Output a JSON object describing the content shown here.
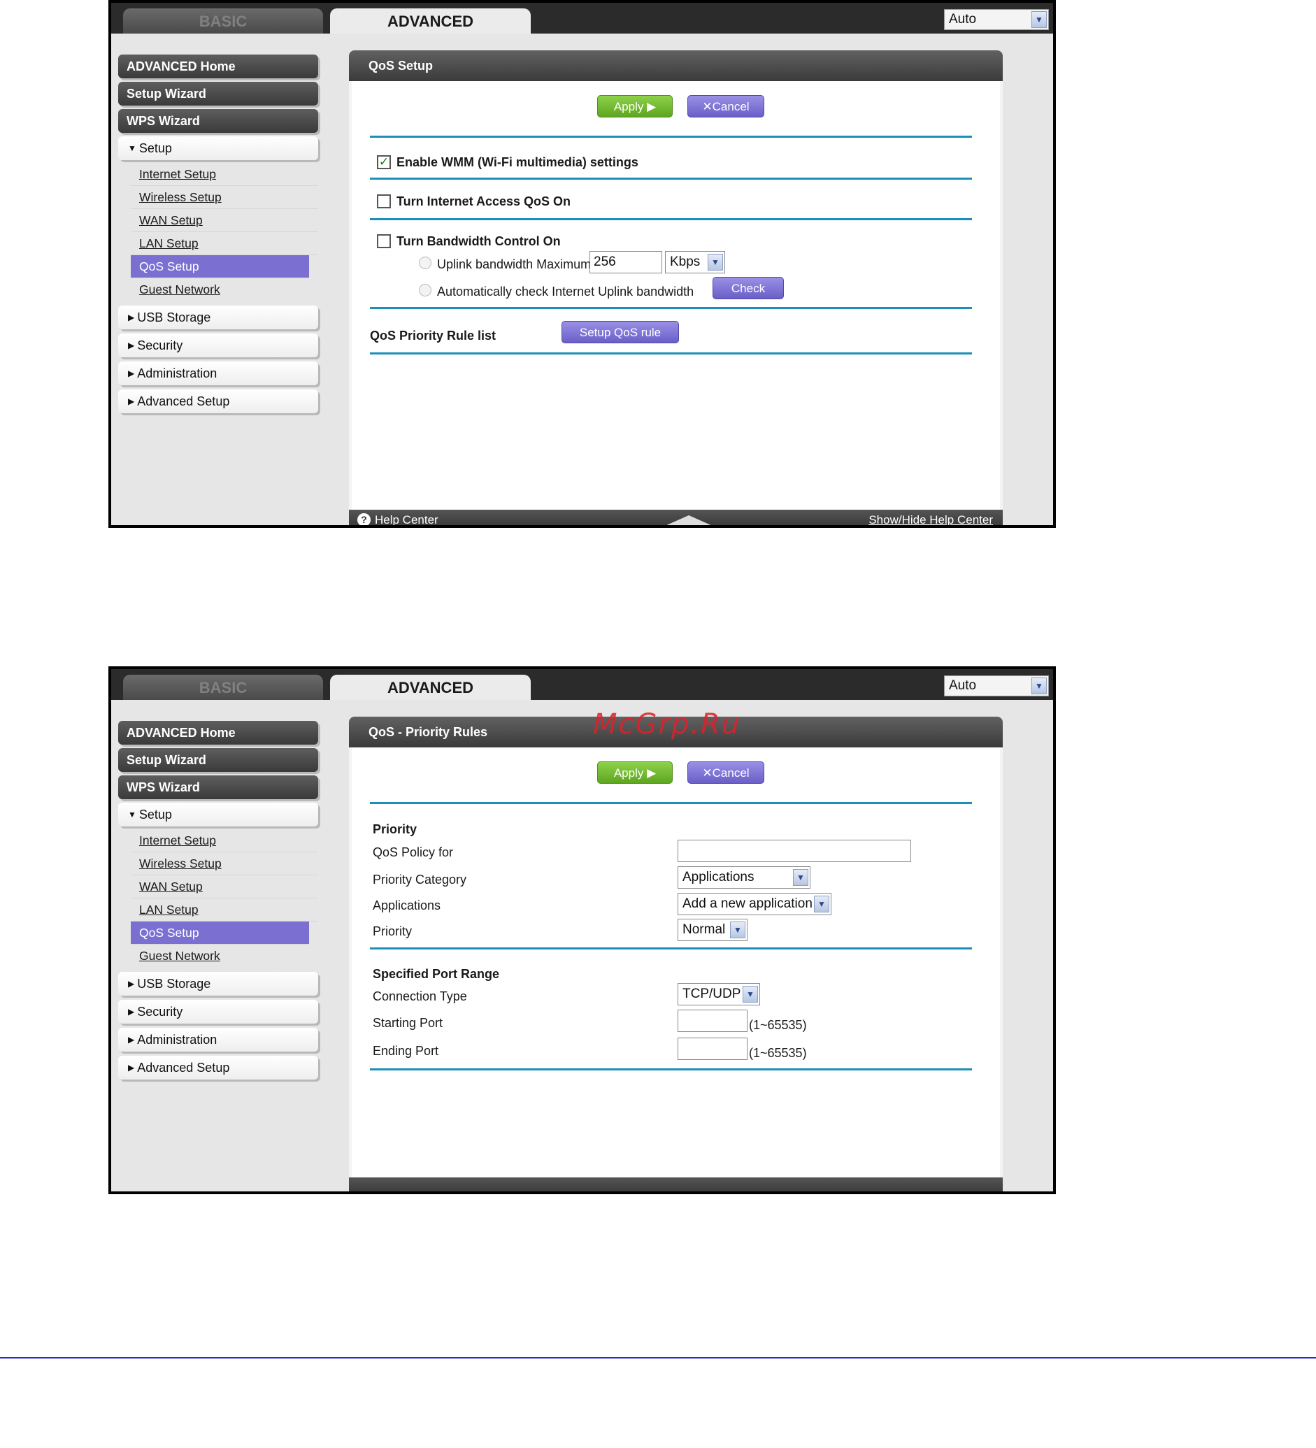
{
  "tabs": {
    "basic": "BASIC",
    "advanced": "ADVANCED"
  },
  "language_select": {
    "value": "Auto"
  },
  "sidebar": {
    "advanced_home": "ADVANCED Home",
    "setup_wizard": "Setup Wizard",
    "wps_wizard": "WPS Wizard",
    "setup": "Setup",
    "setup_items": [
      "Internet Setup",
      "Wireless Setup",
      "WAN Setup",
      "LAN Setup",
      "QoS Setup",
      "Guest Network"
    ],
    "active_item": "QoS Setup",
    "usb_storage": "USB Storage",
    "security": "Security",
    "administration": "Administration",
    "advanced_setup": "Advanced Setup"
  },
  "buttons": {
    "apply": "Apply ▶",
    "cancel": "Cancel"
  },
  "qos_setup": {
    "title": "QoS Setup",
    "enable_wmm": "Enable WMM (Wi-Fi multimedia) settings",
    "enable_wmm_checked": true,
    "internet_qos": "Turn Internet Access QoS On",
    "bandwidth_control": "Turn Bandwidth Control On",
    "uplink_max_label": "Uplink bandwidth Maximum",
    "uplink_max_value": "256",
    "uplink_unit": "Kbps",
    "auto_check_label": "Automatically check Internet Uplink bandwidth",
    "check_button": "Check",
    "rule_list_label": "QoS Priority Rule list",
    "setup_rule_button": "Setup QoS rule",
    "help_center": "Help Center",
    "help_toggle": "Show/Hide Help Center"
  },
  "priority_rules": {
    "title": "QoS - Priority Rules",
    "watermark": "McGrp.Ru",
    "priority_heading": "Priority",
    "policy_for_label": "QoS Policy for",
    "policy_for_value": "",
    "category_label": "Priority Category",
    "category_value": "Applications",
    "applications_label": "Applications",
    "applications_value": "Add a new application",
    "priority_label": "Priority",
    "priority_value": "Normal",
    "port_range_heading": "Specified Port Range",
    "connection_type_label": "Connection Type",
    "connection_type_value": "TCP/UDP",
    "starting_port_label": "Starting Port",
    "starting_port_value": "",
    "ending_port_label": "Ending Port",
    "ending_port_value": "",
    "port_hint": "(1~65535)"
  }
}
